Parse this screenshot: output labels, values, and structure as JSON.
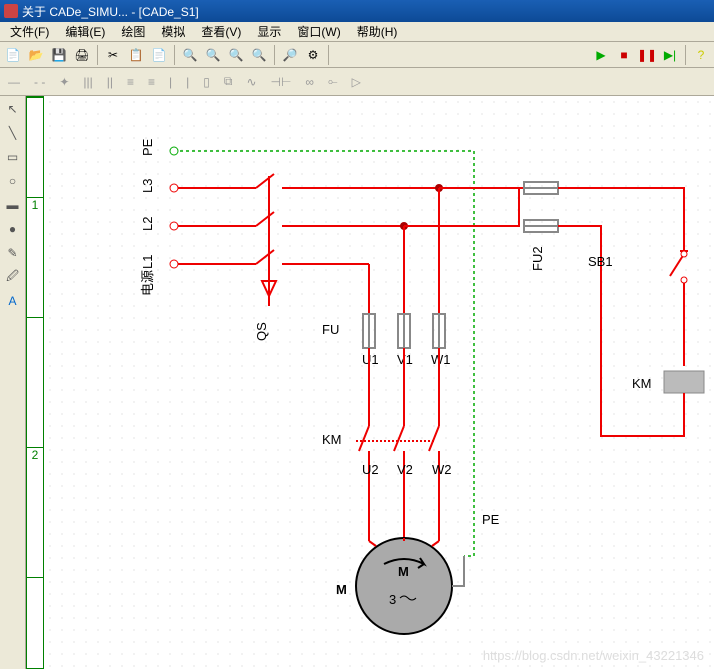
{
  "title": "关于 CADe_SIMU... - [CADe_S1]",
  "menu": {
    "file": "文件(F)",
    "edit": "编辑(E)",
    "draw": "绘图",
    "sim": "模拟",
    "view": "查看(V)",
    "display": "显示",
    "window": "窗口(W)",
    "help": "帮助(H)"
  },
  "ruler": {
    "m1": "1",
    "m2": "2"
  },
  "labels": {
    "PE_top": "PE",
    "L3": "L3",
    "L2": "L2",
    "L1": "L1",
    "source": "电源",
    "QS": "QS",
    "FU": "FU",
    "U1": "U1",
    "V1": "V1",
    "W1": "W1",
    "KM_left": "KM",
    "U2": "U2",
    "V2": "V2",
    "W2": "W2",
    "FU2": "FU2",
    "SB1": "SB1",
    "KM_right": "KM",
    "PE_bot": "PE",
    "M_side": "M",
    "M_in": "M",
    "three": "3"
  },
  "watermark": "https://blog.csdn.net/weixin_43221346",
  "colors": {
    "red": "#e00",
    "green": "#0a0",
    "gray": "#888",
    "accent": "#1a5fb4"
  }
}
